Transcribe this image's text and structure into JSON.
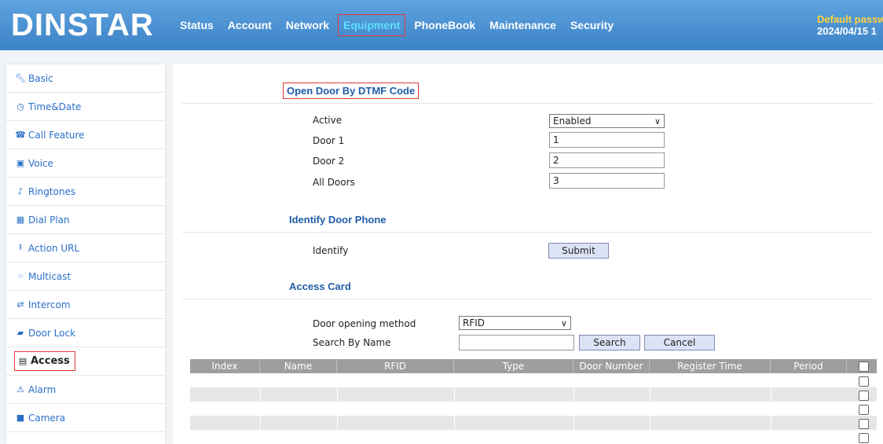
{
  "header": {
    "logo": "DINSTAR",
    "nav": [
      "Status",
      "Account",
      "Network",
      "Equipment",
      "PhoneBook",
      "Maintenance",
      "Security"
    ],
    "active_nav": "Equipment",
    "warning_text": "Default passw",
    "datetime_text": "2024/04/15 1"
  },
  "sidebar": {
    "items": [
      {
        "label": "Basic",
        "icon": "wrench-icon"
      },
      {
        "label": "Time&Date",
        "icon": "clock-icon"
      },
      {
        "label": "Call Feature",
        "icon": "phone-icon"
      },
      {
        "label": "Voice",
        "icon": "voice-icon"
      },
      {
        "label": "Ringtones",
        "icon": "bell-icon"
      },
      {
        "label": "Dial Plan",
        "icon": "dialplan-icon"
      },
      {
        "label": "Action URL",
        "icon": "upload-icon"
      },
      {
        "label": "Multicast",
        "icon": "multicast-icon"
      },
      {
        "label": "Intercom",
        "icon": "transfer-icon"
      },
      {
        "label": "Door Lock",
        "icon": "lock-icon"
      },
      {
        "label": "Access",
        "icon": "access-icon"
      },
      {
        "label": "Alarm",
        "icon": "alarm-icon"
      },
      {
        "label": "Camera",
        "icon": "camera-icon"
      }
    ],
    "active": "Access"
  },
  "dtmf": {
    "title": "Open Door By DTMF Code",
    "active_label": "Active",
    "active_value": "Enabled",
    "door1_label": "Door 1",
    "door1_value": "1",
    "door2_label": "Door 2",
    "door2_value": "2",
    "all_label": "All Doors",
    "all_value": "3"
  },
  "identify": {
    "title": "Identify Door Phone",
    "label": "Identify",
    "button": "Submit"
  },
  "access_card": {
    "title": "Access Card",
    "method_label": "Door opening method",
    "method_value": "RFID",
    "search_label": "Search By Name",
    "search_value": "",
    "search_button": "Search",
    "cancel_button": "Cancel",
    "columns": [
      "Index",
      "Name",
      "RFID",
      "Type",
      "Door Number",
      "Register Time",
      "Period"
    ],
    "empty_rows": 5
  },
  "colors": {
    "header_bg": "#3c83c7",
    "active_nav": "#5ee0ff",
    "highlight_border": "#e53935",
    "section_title": "#1f5ea8",
    "sidebar_link": "#2a6fc9"
  }
}
